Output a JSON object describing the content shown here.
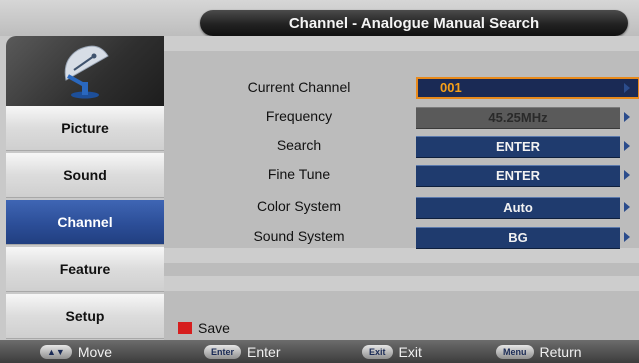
{
  "title": "Channel - Analogue Manual Search",
  "sidebar": {
    "logo_icon": "satellite-dish-icon",
    "items": [
      {
        "label": "Picture",
        "active": false
      },
      {
        "label": "Sound",
        "active": false
      },
      {
        "label": "Channel",
        "active": true
      },
      {
        "label": "Feature",
        "active": false
      },
      {
        "label": "Setup",
        "active": false
      }
    ]
  },
  "settings": [
    {
      "label": "Current Channel",
      "value": "001",
      "state": "selected"
    },
    {
      "label": "Frequency",
      "value": "45.25MHz",
      "state": "disabled"
    },
    {
      "label": "Search",
      "value": "ENTER",
      "state": "normal"
    },
    {
      "label": "Fine Tune",
      "value": "ENTER",
      "state": "normal"
    },
    {
      "label": "Color System",
      "value": "Auto",
      "state": "normal"
    },
    {
      "label": "Sound System",
      "value": "BG",
      "state": "normal"
    }
  ],
  "save": {
    "label": "Save",
    "color": "#d61e1e"
  },
  "footer": {
    "hints": [
      {
        "key": "▲▼",
        "label": "Move"
      },
      {
        "key": "Enter",
        "label": "Enter"
      },
      {
        "key": "Exit",
        "label": "Exit"
      },
      {
        "key": "Menu",
        "label": "Return"
      }
    ]
  },
  "colors": {
    "accent_blue": "#2c4e98",
    "value_box": "#1f3b6e",
    "selection_outline": "#e88a1c",
    "selected_text": "#f6a018"
  }
}
